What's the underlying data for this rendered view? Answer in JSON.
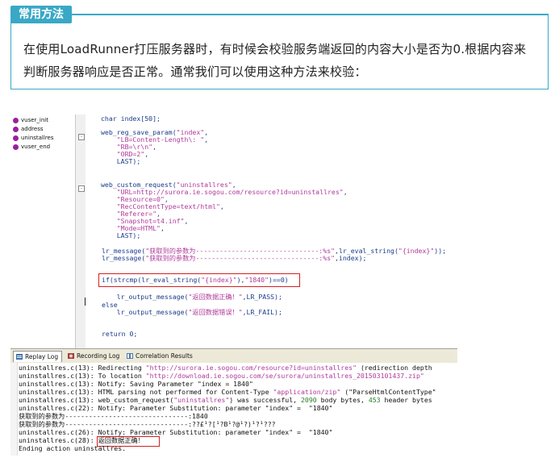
{
  "tip": {
    "title": "常用方法",
    "line1": "在使用LoadRunner打压服务器时，有时候会校验服务端返回的内容大小是否为0.根据内容来",
    "line2": "判断服务器响应是否正常。通常我们可以使用这种方法来校验："
  },
  "tree": [
    "vuser_init",
    "address",
    "uninstallres",
    "vuser_end"
  ],
  "code": {
    "l1": "char index[50];",
    "l2a": "web_reg_save_param(",
    "l2b": "\"index\"",
    "l2c": ",",
    "l3": "\"LB=Content-Length\\: \"",
    "l3b": ",",
    "l4": "\"RB=\\r\\n\"",
    "l4b": ",",
    "l5": "\"ORD=2\"",
    "l5b": ",",
    "l6": "LAST);",
    "l7a": "web_custom_request(",
    "l7b": "\"uninstallres\"",
    "l7c": ",",
    "l8": "\"URL=http://surora.ie.sogou.com/resource?id=uninstallres\"",
    "l8b": ",",
    "l9": "\"Resource=0\"",
    "l9b": ",",
    "l10": "\"RecContentType=text/html\"",
    "l10b": ",",
    "l11": "\"Referer=\"",
    "l11b": ",",
    "l12": "\"Snapshot=t4.inf\"",
    "l12b": ",",
    "l13": "\"Mode=HTML\"",
    "l13b": ",",
    "l14": "LAST);",
    "l15a": "lr_message(",
    "l15b": "\"获取到的参数为-------------------------------:%s\"",
    "l15c": ",lr_eval_string(",
    "l15d": "\"{index}\"",
    "l15e": "));",
    "l16a": "lr_message(",
    "l16b": "\"获取到的参数为-------------------------------:%s\"",
    "l16c": ",index);",
    "l17a": "if(strcmp(lr_eval_string(",
    "l17b": "\"{index}\"",
    "l17c": "),",
    "l17d": "\"1840\"",
    "l17e": ")==0)",
    "l18a": "lr_output_message(",
    "l18b": "\"返回数据正确！\"",
    "l18c": ",LR_PASS);",
    "l19": "else",
    "l20a": "lr_output_message(",
    "l20b": "\"返回数据错误！\"",
    "l20c": ",LR_FAIL);",
    "l21": "return 0;"
  },
  "tabs": [
    {
      "label": "Replay Log"
    },
    {
      "label": "Recording Log"
    },
    {
      "label": "Correlation Results"
    }
  ],
  "log": {
    "r1a": "uninstallres.c(13): Redirecting ",
    "r1b": "\"http://surora.ie.sogou.com/resource?id=uninstallres\"",
    "r1c": " (redirection depth",
    "r2a": "uninstallres.c(13): To location ",
    "r2b": "\"http://download.ie.sogou.com/se/surora/uninstallres_201503101437.zip\"",
    "r3": "uninstallres.c(13): Notify: Saving Parameter \"index = 1840\"",
    "r4a": "uninstallres.c(13): HTML parsing not performed for Content-Type ",
    "r4b": "\"application/zip\"",
    "r4c": " (\"ParseHtmlContentType\"",
    "r5a": "uninstallres.c(13): web_custom_request(",
    "r5b": "\"uninstallres\"",
    "r5c": ") was successful, ",
    "r5d": "2090",
    "r5e": " body bytes, ",
    "r5f": "453",
    "r5g": " header bytes",
    "r6": "uninstallres.c(22): Notify: Parameter Substitution: parameter \"index\" =  \"1840\"",
    "r7": "获取到的参数为-------------------------------:1840",
    "r8": "获取到的参数为-------------------------------:??£¹?[¹?B¹?@¹?)¹?¹???",
    "r9": "uninstallres.c(26): Notify: Parameter Substitution: parameter \"index\" =  \"1840\"",
    "r10a": "uninstallres.c(28): ",
    "r10b": "返回数据正确！",
    "r11": "Ending action uninstallres."
  },
  "colors": {
    "accent": "#39a8c6",
    "highlight": "#d42020"
  }
}
